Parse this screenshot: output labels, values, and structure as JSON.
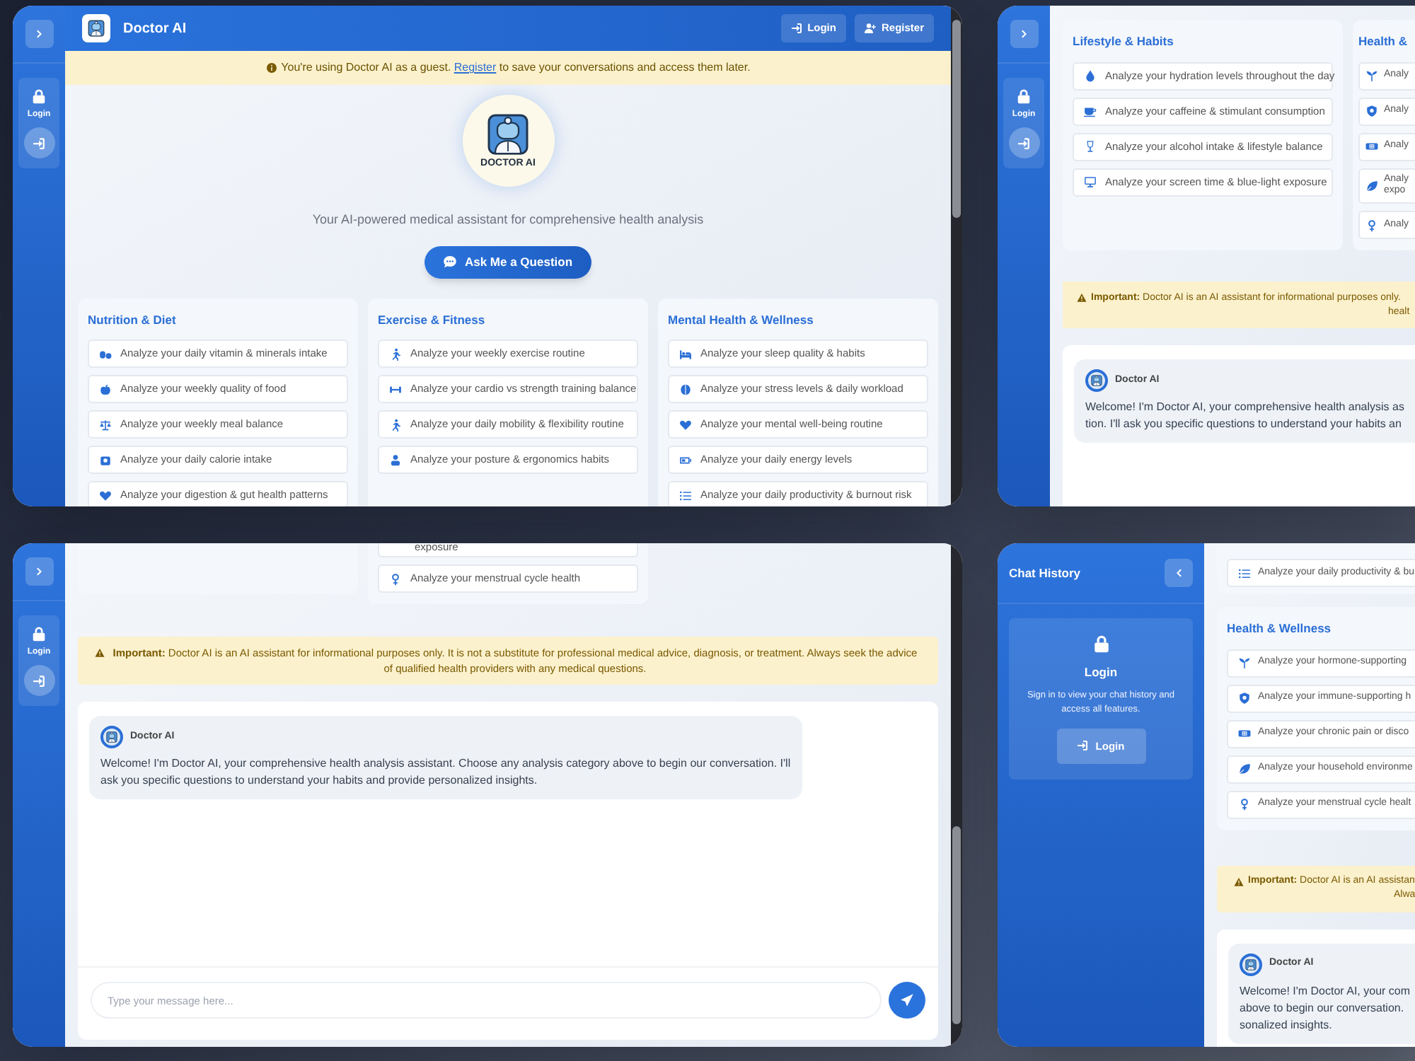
{
  "top_left": {
    "sidebar": {
      "login_label": "Login"
    },
    "header": {
      "title": "Doctor AI",
      "buttons": [
        "Login",
        "Register"
      ]
    },
    "guest_banner": {
      "before": "You're using Doctor AI as a guest.",
      "link": "Register",
      "after": "to save your conversations and access them later."
    },
    "logo_text": "DOCTOR AI",
    "tagline": "Your AI-powered medical assistant for comprehensive health analysis",
    "ask_button": "Ask Me a Question",
    "categories": [
      {
        "title": "Nutrition & Diet",
        "items": [
          "Analyze your daily vitamin & minerals intake",
          "Analyze your weekly quality of food",
          "Analyze your weekly meal balance",
          "Analyze your daily calorie intake",
          "Analyze your digestion & gut health patterns"
        ]
      },
      {
        "title": "Exercise & Fitness",
        "items": [
          "Analyze your weekly exercise routine",
          "Analyze your cardio vs strength training balance",
          "Analyze your daily mobility & flexibility routine",
          "Analyze your posture & ergonomics habits"
        ]
      },
      {
        "title": "Mental Health & Wellness",
        "items": [
          "Analyze your sleep quality & habits",
          "Analyze your stress levels & daily workload",
          "Analyze your mental well-being routine",
          "Analyze your daily energy levels",
          "Analyze your daily productivity & burnout risk"
        ]
      }
    ]
  },
  "top_right": {
    "sidebar": {
      "login_label": "Login"
    },
    "categories": [
      {
        "title": "Lifestyle & Habits",
        "items": [
          "Analyze your hydration levels throughout the day",
          "Analyze your caffeine & stimulant consumption",
          "Analyze your alcohol intake & lifestyle balance",
          "Analyze your screen time & blue-light exposure"
        ]
      },
      {
        "title": "Health &",
        "items": [
          "Analy",
          "Analy",
          "Analy",
          "Analy expo",
          "Analy"
        ]
      }
    ],
    "notice": {
      "lines": [
        "**Important:** Doctor AI is an AI assistant for informational purposes only.",
        "healt"
      ]
    },
    "chat": {
      "sender": "Doctor AI",
      "lines": [
        "Welcome! I'm Doctor AI, your comprehensive health analysis as",
        "tion. I'll ask you specific questions to understand your habits an"
      ]
    }
  },
  "bottom_left": {
    "sidebar": {
      "login_label": "Login"
    },
    "partial_item": "exposure",
    "items": [
      "Analyze your menstrual cycle health"
    ],
    "notice": {
      "text": "**Important:** Doctor AI is an AI assistant for informational purposes only. It is not a substitute for professional medical advice, diagnosis, or treatment. Always seek the advice of qualified health providers with any medical questions."
    },
    "chat": {
      "sender": "Doctor AI",
      "message": "Welcome! I'm Doctor AI, your comprehensive health analysis assistant. Choose any analysis category above to begin our conversation. I'll ask you specific questions to understand your habits and provide personalized insights."
    },
    "composer": {
      "placeholder": "Type your message here..."
    }
  },
  "bottom_right": {
    "sidebar": {
      "title": "Chat History",
      "login_title": "Login",
      "login_hint": "Sign in to view your chat history and access all features.",
      "login_button": "Login"
    },
    "top_item": "Analyze your daily productivity & bu",
    "category": {
      "title": "Health & Wellness",
      "items": [
        "Analyze your hormone-supporting",
        "Analyze your immune-supporting h",
        "Analyze your chronic pain or disco",
        "Analyze your household environme",
        "Analyze your menstrual cycle healt"
      ]
    },
    "notice": {
      "lines": [
        "**Important:** Doctor AI is an AI assistan",
        "Alwa"
      ]
    },
    "chat": {
      "sender": "Doctor AI",
      "lines": [
        "Welcome! I'm Doctor AI, your com",
        "above to begin our conversation.",
        "sonalized insights."
      ]
    }
  }
}
